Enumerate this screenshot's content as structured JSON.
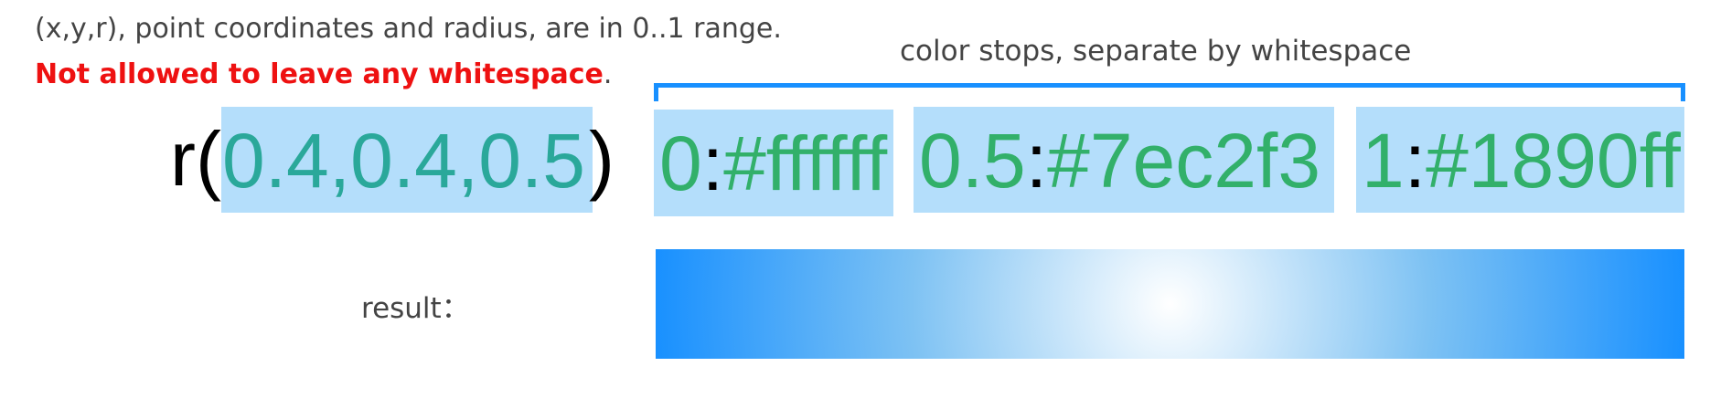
{
  "hint": {
    "coordinates_text": "(x,y,r), point coordinates and radius, are in 0..1 range.",
    "warning_text": "Not allowed to leave any whitespace",
    "warning_suffix": "."
  },
  "stops_caption": "color stops, separate by whitespace",
  "expression": {
    "function_open": "r(",
    "params": "0.4,0.4,0.5",
    "function_close": ")"
  },
  "color_stops": [
    {
      "position": "0",
      "separator": ":",
      "color": "#ffffff"
    },
    {
      "position": "0.5",
      "separator": ":",
      "color": "#7ec2f3"
    },
    {
      "position": "1",
      "separator": ":",
      "color": "#1890ff"
    }
  ],
  "result": {
    "label": "result："
  },
  "colors": {
    "accent": "#1890ff",
    "highlight": "#b4defb",
    "warning": "#ee1111",
    "param_text": "#2aa89a",
    "stop_text": "#32b06a"
  }
}
